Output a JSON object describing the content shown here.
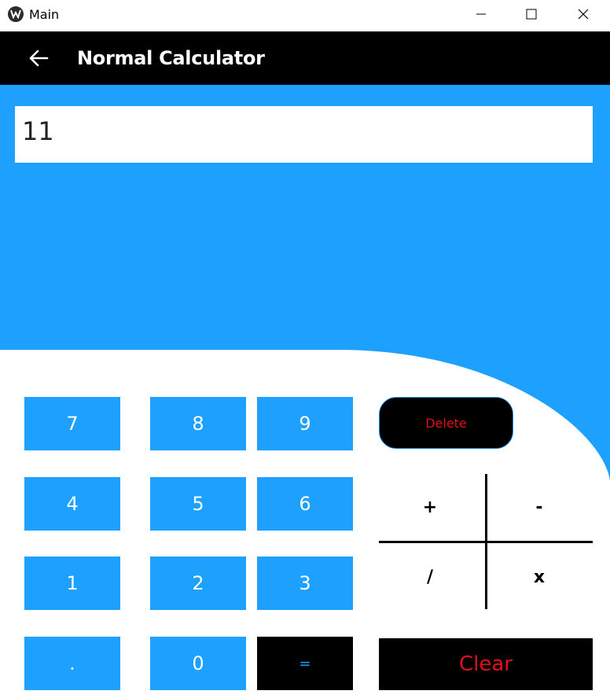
{
  "window": {
    "title": "Main"
  },
  "appbar": {
    "title": "Normal Calculator"
  },
  "display": {
    "value": "11"
  },
  "keys": {
    "seven": "7",
    "eight": "8",
    "nine": "9",
    "four": "4",
    "five": "5",
    "six": "6",
    "one": "1",
    "two": "2",
    "three": "3",
    "dot": ".",
    "zero": "0",
    "equals": "="
  },
  "actions": {
    "delete": "Delete",
    "clear": "Clear"
  },
  "operators": {
    "plus": "+",
    "minus": "-",
    "divide": "/",
    "multiply": "x"
  },
  "colors": {
    "accent": "#1ea0ff",
    "dark": "#000000",
    "danger": "#e0101a",
    "surface": "#ffffff"
  }
}
